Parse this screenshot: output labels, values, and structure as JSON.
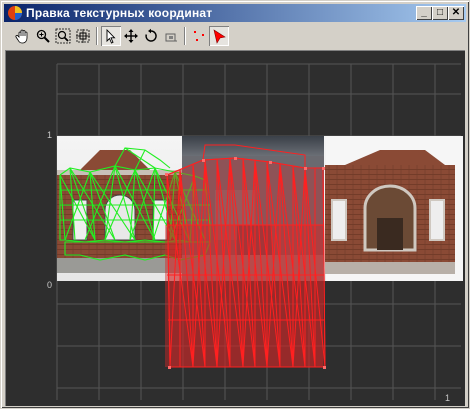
{
  "window": {
    "title": "Правка текстурных координат",
    "controls": {
      "minimize": "_",
      "maximize": "□",
      "close": "✕"
    }
  },
  "toolbar": {
    "tools": [
      {
        "name": "pan",
        "icon": "hand-icon"
      },
      {
        "name": "zoom",
        "icon": "magnifier-icon"
      },
      {
        "name": "zoom-region",
        "icon": "zoom-region-icon"
      },
      {
        "name": "zoom-extents",
        "icon": "zoom-extents-icon"
      },
      {
        "name": "select",
        "icon": "arrow-select-icon",
        "pressed": true
      },
      {
        "name": "move",
        "icon": "move-icon"
      },
      {
        "name": "rotate",
        "icon": "rotate-icon"
      },
      {
        "name": "scale",
        "icon": "scale-icon"
      },
      {
        "name": "show-vertices",
        "icon": "vertices-icon"
      },
      {
        "name": "select-vertices",
        "icon": "red-arrow-icon",
        "pressed": true
      }
    ]
  },
  "viewport": {
    "axis_labels": {
      "v_one": "1",
      "v_zero": "0",
      "u_one": "1"
    },
    "colors": {
      "background": "#2e2e2e",
      "grid": "#555555",
      "mesh_selected": "#ff2020",
      "mesh_other": "#22ee22"
    }
  }
}
